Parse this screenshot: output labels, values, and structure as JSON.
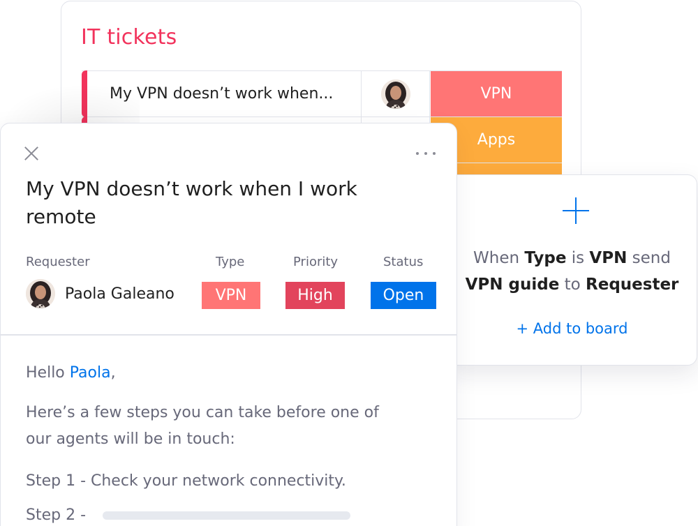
{
  "colors": {
    "accent_red": "#f2335c",
    "vpn_salmon": "#ff7575",
    "apps_orange": "#fdab3d",
    "priority_high": "#e2445c",
    "status_open": "#0073ea",
    "link_blue": "#0073ea"
  },
  "board": {
    "title": "IT tickets",
    "rows": [
      {
        "name": "My VPN doesn’t work when...",
        "has_avatar": true,
        "type": "VPN",
        "type_color": "#ff7575"
      },
      {
        "name": "",
        "has_avatar": false,
        "type": "Apps",
        "type_color": "#fdab3d"
      },
      {
        "name": "",
        "has_avatar": false,
        "type": "",
        "type_color": "#fdab3d"
      }
    ]
  },
  "automation": {
    "icon": "plus-icon",
    "recipe": {
      "p1": "When ",
      "b1": "Type",
      "p2": " is ",
      "b2": "VPN",
      "p3": " send",
      "b3": "VPN guide",
      "p4": " to ",
      "b4": "Requester"
    },
    "add_label": "+ Add to board"
  },
  "item": {
    "title": "My VPN doesn’t work when I work remote",
    "columns": {
      "requester": "Requester",
      "type": "Type",
      "priority": "Priority",
      "status": "Status"
    },
    "requester_name": "Paola Galeano",
    "type_value": "VPN",
    "priority_value": "High",
    "status_value": "Open",
    "body": {
      "greeting": "Hello ",
      "greeting_name": "Paola",
      "greeting_end": ",",
      "intro_line1": "Here’s a few steps you can take before one of",
      "intro_line2": "our agents will be in touch:",
      "step1": "Step 1 - Check your network connectivity.",
      "step2": "Step 2 -"
    }
  }
}
